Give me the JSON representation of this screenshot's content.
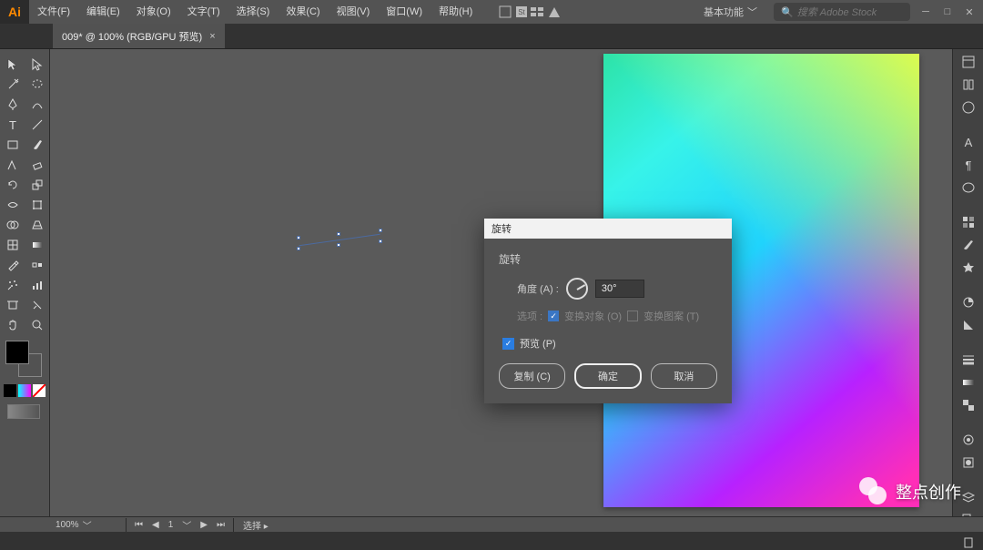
{
  "app": {
    "logo": "Ai"
  },
  "menu": {
    "items": [
      "文件(F)",
      "编辑(E)",
      "对象(O)",
      "文字(T)",
      "选择(S)",
      "效果(C)",
      "视图(V)",
      "窗口(W)",
      "帮助(H)"
    ]
  },
  "workspace": {
    "label": "基本功能"
  },
  "search": {
    "placeholder": "搜索 Adobe Stock"
  },
  "tab": {
    "title": "009* @ 100% (RGB/GPU 预览)",
    "close": "×"
  },
  "dialog": {
    "title": "旋转",
    "section": "旋转",
    "angle_label": "角度 (A) :",
    "angle_value": "30°",
    "options_label": "选项 :",
    "opt1": "变换对象 (O)",
    "opt2": "变换图案 (T)",
    "preview": "预览 (P)",
    "copy": "复制 (C)",
    "ok": "确定",
    "cancel": "取消"
  },
  "status": {
    "zoom": "100%",
    "page": "1",
    "selection": "选择"
  },
  "watermark": {
    "text": "整点创作"
  }
}
